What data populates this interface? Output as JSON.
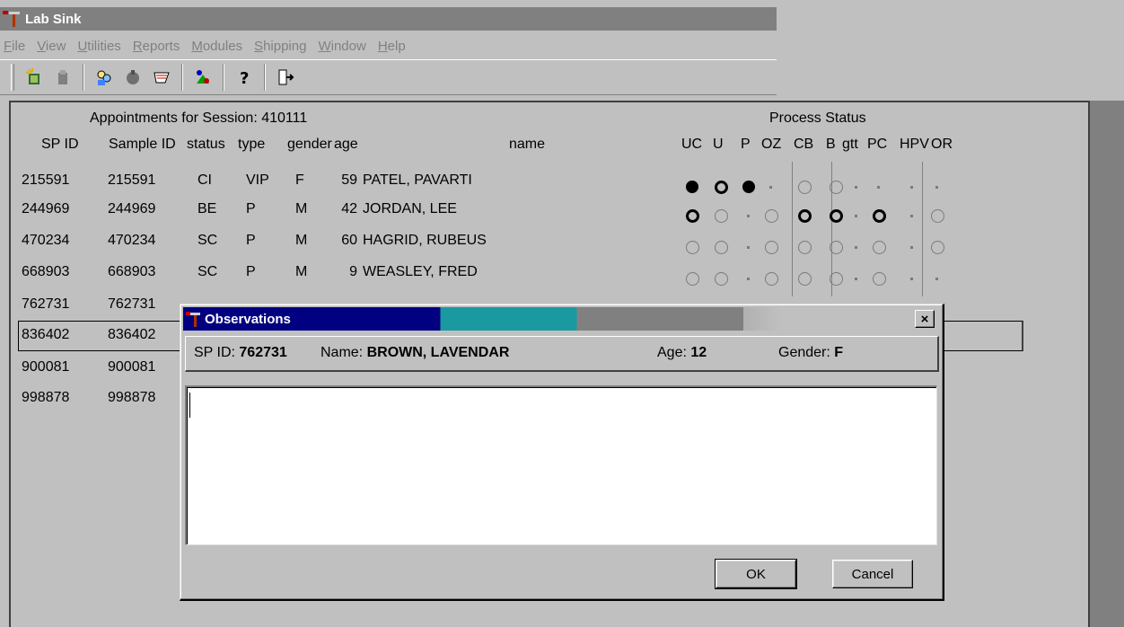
{
  "window": {
    "title": "Lab Sink"
  },
  "menu": [
    "File",
    "View",
    "Utilities",
    "Reports",
    "Modules",
    "Shipping",
    "Window",
    "Help"
  ],
  "toolbar": {
    "icons": [
      "new-icon",
      "open-icon",
      "people-icon",
      "stop-icon",
      "scan-icon",
      "specimen-icon",
      "help-icon",
      "exit-icon"
    ]
  },
  "session": {
    "title": "Appointments for Session: 410111",
    "process_title": "Process Status"
  },
  "columns": {
    "sp_id": "SP ID",
    "sample_id": "Sample ID",
    "status": "status",
    "type": "type",
    "gender": "gender",
    "age": "age",
    "name": "name",
    "process": [
      "UC",
      "U",
      "P",
      "OZ",
      "CB",
      "B",
      "gtt",
      "PC",
      "HPV",
      "OR"
    ]
  },
  "rows": [
    {
      "sp_id": "215591",
      "sample_id": "215591",
      "status": "CI",
      "type": "VIP",
      "gender": "F",
      "age": "59",
      "name": "PATEL, PAVARTI",
      "process": [
        "solid",
        "bold",
        "solid",
        "dot",
        "open",
        "open",
        "dot",
        "dot",
        "dot",
        "dot"
      ]
    },
    {
      "sp_id": "244969",
      "sample_id": "244969",
      "status": "BE",
      "type": "P",
      "gender": "M",
      "age": "42",
      "name": "JORDAN, LEE",
      "process": [
        "bold",
        "open",
        "dot",
        "open",
        "bold",
        "bold",
        "dot",
        "bold",
        "dot",
        "open"
      ]
    },
    {
      "sp_id": "470234",
      "sample_id": "470234",
      "status": "SC",
      "type": "P",
      "gender": "M",
      "age": "60",
      "name": "HAGRID, RUBEUS",
      "process": [
        "open",
        "open",
        "dot",
        "open",
        "open",
        "open",
        "dot",
        "open",
        "dot",
        "open"
      ]
    },
    {
      "sp_id": "668903",
      "sample_id": "668903",
      "status": "SC",
      "type": "P",
      "gender": "M",
      "age": "9",
      "name": "WEASLEY, FRED",
      "process": [
        "open",
        "open",
        "dot",
        "open",
        "open",
        "open",
        "dot",
        "open",
        "dot",
        "dot"
      ]
    },
    {
      "sp_id": "762731",
      "sample_id": "762731",
      "status": "",
      "type": "",
      "gender": "",
      "age": "",
      "name": "",
      "process": [
        "",
        "",
        "",
        "",
        "",
        "",
        "",
        "",
        "",
        "dot"
      ]
    },
    {
      "sp_id": "836402",
      "sample_id": "836402",
      "status": "",
      "type": "",
      "gender": "",
      "age": "",
      "name": "",
      "process": [
        "",
        "",
        "",
        "",
        "",
        "",
        "",
        "",
        "",
        "dot"
      ]
    },
    {
      "sp_id": "900081",
      "sample_id": "900081",
      "status": "",
      "type": "",
      "gender": "",
      "age": "",
      "name": "",
      "process": [
        "",
        "",
        "",
        "",
        "",
        "",
        "",
        "",
        "",
        "dot"
      ]
    },
    {
      "sp_id": "998878",
      "sample_id": "998878",
      "status": "",
      "type": "",
      "gender": "",
      "age": "",
      "name": "",
      "process": [
        "",
        "",
        "",
        "",
        "",
        "",
        "",
        "",
        "",
        "dot"
      ]
    }
  ],
  "dialog": {
    "title": "Observations",
    "close": "×",
    "sp_id_label": "SP ID:",
    "sp_id_value": "762731",
    "name_label": "Name:",
    "name_value": "BROWN, LAVENDAR",
    "age_label": "Age:",
    "age_value": "12",
    "gender_label": "Gender:",
    "gender_value": "F",
    "notes_value": "",
    "ok_label": "OK",
    "cancel_label": "Cancel"
  }
}
